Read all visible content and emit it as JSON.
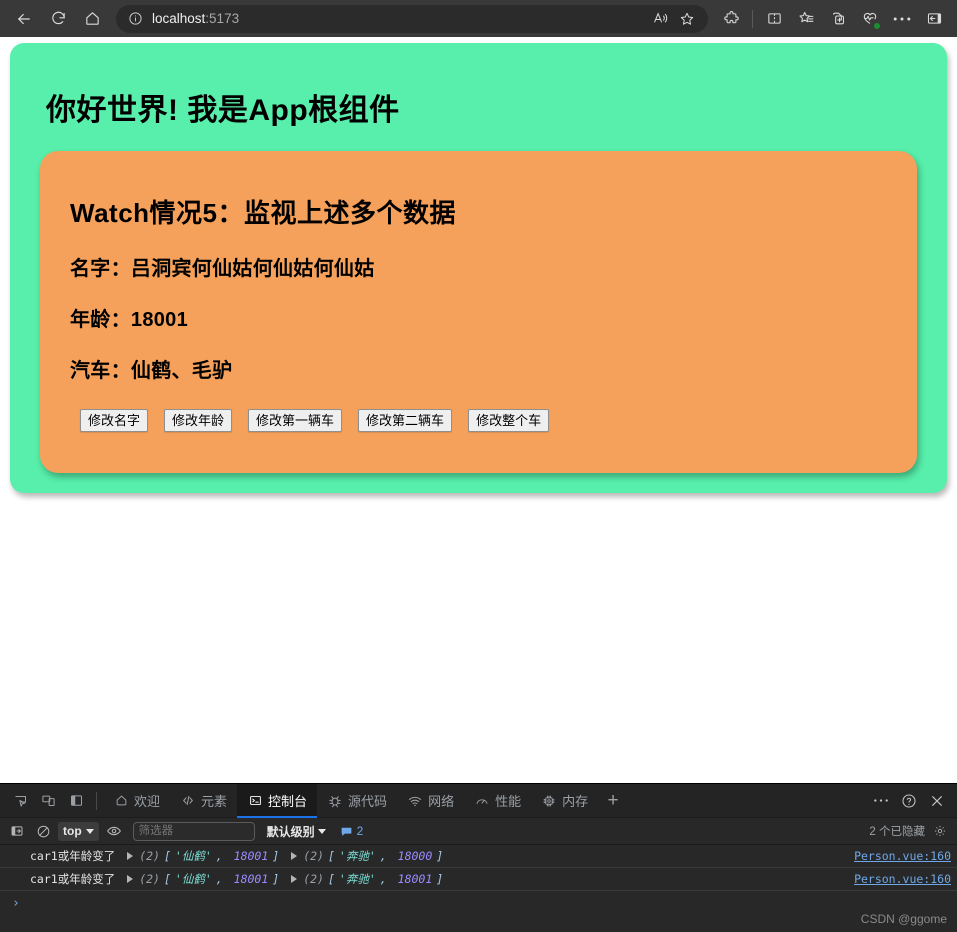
{
  "browser": {
    "back_label": "back-arrow",
    "refresh_label": "refresh",
    "home_label": "home",
    "url_host": "localhost",
    "url_port": ":5173",
    "read_aloud_label": "read-aloud",
    "favorite_label": "add-favorite",
    "extensions_label": "extensions",
    "split_screen_label": "split-screen",
    "collections_label": "collections",
    "add_tab_label": "browser-essentials",
    "more_label": "settings-and-more",
    "sidebar_label": "sidebar"
  },
  "page": {
    "app_title": "你好世界! 我是App根组件",
    "card": {
      "title": "Watch情况5：监视上述多个数据",
      "name_line": "名字：吕洞宾何仙姑何仙姑何仙姑",
      "age_line": "年龄：18001",
      "car_line": "汽车：仙鹤、毛驴",
      "buttons": [
        "修改名字",
        "修改年龄",
        "修改第一辆车",
        "修改第二辆车",
        "修改整个车"
      ]
    },
    "colors": {
      "app_bg": "#57efab",
      "card_bg": "#f5a15b"
    }
  },
  "devtools": {
    "tabs": [
      {
        "label": "欢迎",
        "icon": "home-icon",
        "active": false
      },
      {
        "label": "元素",
        "icon": "code-icon",
        "active": false
      },
      {
        "label": "控制台",
        "icon": "console-icon",
        "active": true
      },
      {
        "label": "源代码",
        "icon": "bug-icon",
        "active": false
      },
      {
        "label": "网络",
        "icon": "network-icon",
        "active": false
      },
      {
        "label": "性能",
        "icon": "performance-icon",
        "active": false
      },
      {
        "label": "内存",
        "icon": "memory-icon",
        "active": false
      }
    ],
    "add_tab": "+",
    "more_tools": "…",
    "help": "?",
    "close": "×",
    "toolbar": {
      "sidebar_toggle": "console-sidebar-icon",
      "clear_console": "clear-console-icon",
      "context": "top",
      "eye": "live-expression-icon",
      "filter_placeholder": "筛选器",
      "filter_value": "",
      "level": "默认级别",
      "message_count": "2",
      "hidden_count": "2 个已隐藏",
      "settings": "settings-gear-icon"
    },
    "logs": [
      {
        "message": "car1或年龄变了",
        "arrays": [
          {
            "length": "(2)",
            "items": [
              "'仙鹤'",
              "18001"
            ]
          },
          {
            "length": "(2)",
            "items": [
              "'奔驰'",
              "18000"
            ]
          }
        ],
        "source": "Person.vue:160"
      },
      {
        "message": "car1或年龄变了",
        "arrays": [
          {
            "length": "(2)",
            "items": [
              "'仙鹤'",
              "18001"
            ]
          },
          {
            "length": "(2)",
            "items": [
              "'奔驰'",
              "18001"
            ]
          }
        ],
        "source": "Person.vue:160"
      }
    ],
    "prompt": "›",
    "watermark": "CSDN @ggome"
  }
}
